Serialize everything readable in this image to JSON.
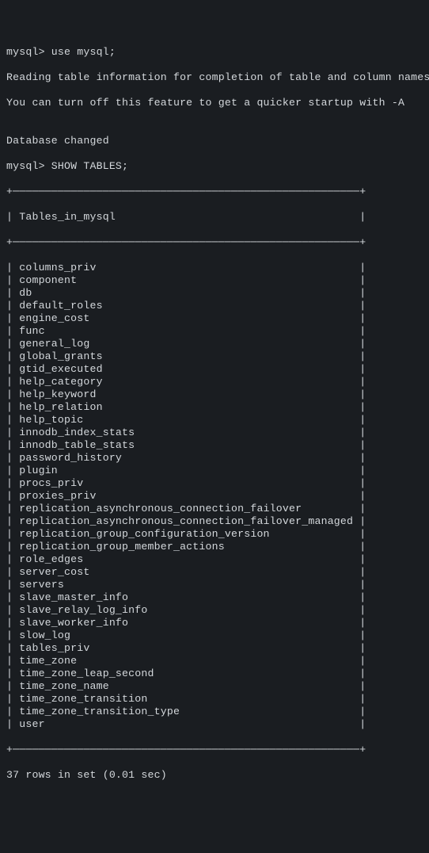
{
  "prompt1": "mysql> use mysql;",
  "msg1": "Reading table information for completion of table and column names",
  "msg2": "You can turn off this feature to get a quicker startup with -A",
  "blank": "",
  "msg3": "Database changed",
  "prompt2": "mysql> SHOW TABLES;",
  "topBorder": "+──────────────────────────────────────────────────────+",
  "header": "| Tables_in_mysql                                      |",
  "midBorder": "+──────────────────────────────────────────────────────+",
  "rows": [
    "| columns_priv                                         |",
    "| component                                            |",
    "| db                                                   |",
    "| default_roles                                        |",
    "| engine_cost                                          |",
    "| func                                                 |",
    "| general_log                                          |",
    "| global_grants                                        |",
    "| gtid_executed                                        |",
    "| help_category                                        |",
    "| help_keyword                                         |",
    "| help_relation                                        |",
    "| help_topic                                           |",
    "| innodb_index_stats                                   |",
    "| innodb_table_stats                                   |",
    "| password_history                                     |",
    "| plugin                                               |",
    "| procs_priv                                           |",
    "| proxies_priv                                         |",
    "| replication_asynchronous_connection_failover         |",
    "| replication_asynchronous_connection_failover_managed |",
    "| replication_group_configuration_version              |",
    "| replication_group_member_actions                     |",
    "| role_edges                                           |",
    "| server_cost                                          |",
    "| servers                                              |",
    "| slave_master_info                                    |",
    "| slave_relay_log_info                                 |",
    "| slave_worker_info                                    |",
    "| slow_log                                             |",
    "| tables_priv                                          |",
    "| time_zone                                            |",
    "| time_zone_leap_second                                |",
    "| time_zone_name                                       |",
    "| time_zone_transition                                 |",
    "| time_zone_transition_type                            |",
    "| user                                                 |"
  ],
  "bottomBorder": "+──────────────────────────────────────────────────────+",
  "footer": "37 rows in set (0.01 sec)"
}
